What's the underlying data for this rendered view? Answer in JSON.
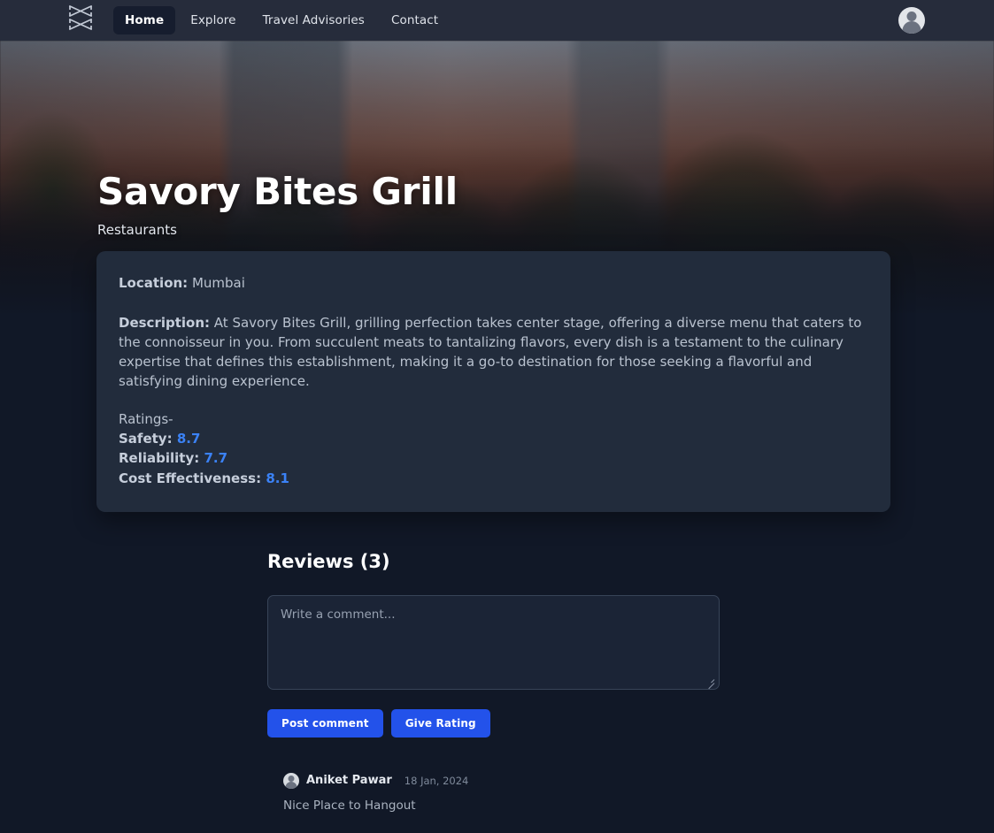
{
  "navbar": {
    "logo_icon": "crossed-x-logo-icon",
    "links": [
      {
        "label": "Home",
        "active": true
      },
      {
        "label": "Explore",
        "active": false
      },
      {
        "label": "Travel Advisories",
        "active": false
      },
      {
        "label": "Contact",
        "active": false
      }
    ],
    "avatar_icon": "user-avatar-icon"
  },
  "hero": {
    "title": "Savory Bites Grill",
    "subtitle": "Restaurants"
  },
  "info_card": {
    "location_label": "Location:",
    "location_value": "Mumbai",
    "description_label": "Description:",
    "description_value": "At Savory Bites Grill, grilling perfection takes center stage, offering a diverse menu that caters to the connoisseur in you. From succulent meats to tantalizing flavors, every dish is a testament to the culinary expertise that defines this establishment, making it a go-to destination for those seeking a flavorful and satisfying dining experience.",
    "ratings_heading": "Ratings-",
    "ratings": [
      {
        "label": "Safety:",
        "value": "8.7"
      },
      {
        "label": "Reliability:",
        "value": "7.7"
      },
      {
        "label": "Cost Effectiveness:",
        "value": "8.1"
      }
    ],
    "accent_color": "#3b82f6"
  },
  "reviews": {
    "title": "Reviews (3)",
    "comment_placeholder": "Write a comment...",
    "comment_value": "",
    "post_button": "Post comment",
    "rating_button": "Give Rating",
    "button_color": "#2352ea",
    "items": [
      {
        "author": "Aniket Pawar",
        "date": "18 Jan, 2024",
        "text": "Nice Place to Hangout",
        "avatar_icon": "user-avatar-icon"
      }
    ]
  }
}
